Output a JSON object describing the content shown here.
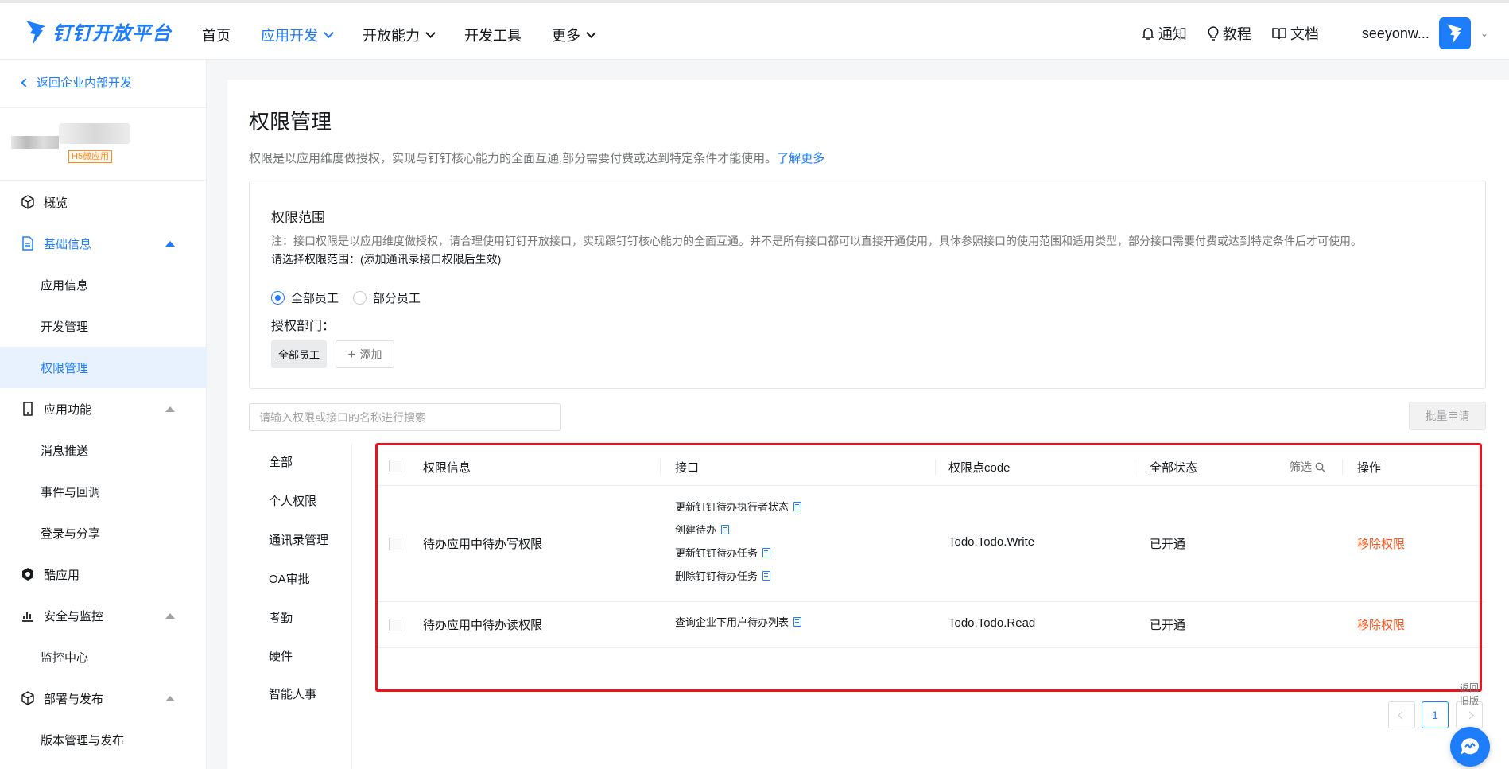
{
  "brand": {
    "name": "钉钉开放平台"
  },
  "nav": {
    "items": [
      {
        "label": "首页"
      },
      {
        "label": "应用开发"
      },
      {
        "label": "开放能力"
      },
      {
        "label": "开发工具"
      },
      {
        "label": "更多"
      }
    ],
    "right": {
      "notify": "通知",
      "tutorial": "教程",
      "docs": "文档",
      "user": "seeyonw..."
    }
  },
  "sidebar": {
    "back": "返回企业内部开发",
    "app_tag": "H5微应用",
    "items": [
      {
        "label": "概览",
        "icon": "cube-icon"
      },
      {
        "label": "基础信息",
        "icon": "document-icon"
      },
      {
        "label": "应用信息"
      },
      {
        "label": "开发管理"
      },
      {
        "label": "权限管理"
      },
      {
        "label": "应用功能",
        "icon": "mobile-icon"
      },
      {
        "label": "消息推送"
      },
      {
        "label": "事件与回调"
      },
      {
        "label": "登录与分享"
      },
      {
        "label": "酷应用",
        "icon": "cool-app-icon"
      },
      {
        "label": "安全与监控",
        "icon": "bar-chart-icon"
      },
      {
        "label": "监控中心"
      },
      {
        "label": "部署与发布",
        "icon": "cube-icon"
      },
      {
        "label": "版本管理与发布"
      }
    ]
  },
  "page": {
    "title": "权限管理",
    "desc": "权限是以应用维度做授权，实现与钉钉核心能力的全面互通,部分需要付费或达到特定条件才能使用。",
    "learn_more": "了解更多",
    "scope": {
      "title": "权限范围",
      "note": "注：接口权限是以应用维度做授权，请合理使用钉钉开放接口，实现跟钉钉核心能力的全面互通。并不是所有接口都可以直接开通使用，具体参照接口的使用范围和适用类型，部分接口需要付费或达到特定条件后才可使用。",
      "select_hint": "请选择权限范围：(添加通讯录接口权限后生效)",
      "radio_all": "全部员工",
      "radio_part": "部分员工",
      "selected": "all",
      "dept_label": "授权部门：",
      "dept_tag": "全部员工",
      "add": "添加"
    },
    "search_placeholder": "请输入权限或接口的名称进行搜索",
    "batch": "批量申请",
    "categories": [
      "全部",
      "个人权限",
      "通讯录管理",
      "OA审批",
      "考勤",
      "硬件",
      "智能人事"
    ],
    "table": {
      "headers": {
        "info": "权限信息",
        "api": "接口",
        "code": "权限点code",
        "status": "全部状态",
        "filter": "筛选",
        "action": "操作"
      },
      "rows": [
        {
          "info": "待办应用中待办写权限",
          "apis": [
            "更新钉钉待办执行者状态",
            "创建待办",
            "更新钉钉待办任务",
            "删除钉钉待办任务"
          ],
          "code": "Todo.Todo.Write",
          "status": "已开通",
          "action": "移除权限"
        },
        {
          "info": "待办应用中待办读权限",
          "apis": [
            "查询企业下用户待办列表"
          ],
          "code": "Todo.Todo.Read",
          "status": "已开通",
          "action": "移除权限"
        }
      ]
    },
    "pagination": {
      "current": "1"
    },
    "old_version": "返回旧版"
  },
  "colors": {
    "accent": "#1d7dfa",
    "danger": "#ff5219",
    "highlight": "#e8141d"
  }
}
